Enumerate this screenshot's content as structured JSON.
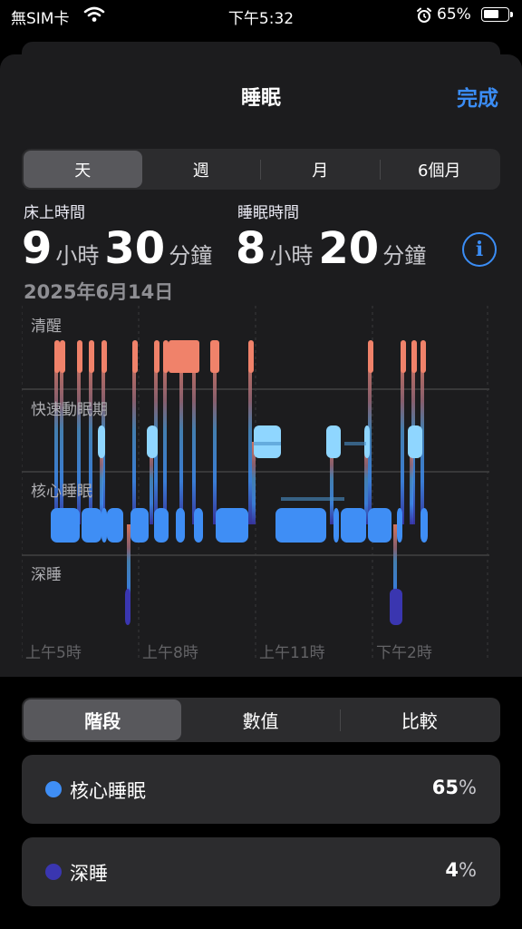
{
  "status_bar": {
    "carrier": "無SIM卡",
    "time": "下午5:32",
    "battery_percent": "65%",
    "battery_level": 0.65
  },
  "nav": {
    "title": "睡眠",
    "done_label": "完成"
  },
  "range_tabs": [
    {
      "label": "天",
      "selected": true
    },
    {
      "label": "週",
      "selected": false
    },
    {
      "label": "月",
      "selected": false
    },
    {
      "label": "6個月",
      "selected": false
    }
  ],
  "summary": {
    "in_bed": {
      "label": "床上時間",
      "hours": "9",
      "hours_unit": "小時",
      "minutes": "30",
      "minutes_unit": "分鐘"
    },
    "asleep": {
      "label": "睡眠時間",
      "hours": "8",
      "hours_unit": "小時",
      "minutes": "20",
      "minutes_unit": "分鐘"
    },
    "date": "2025年6月14日",
    "info_glyph": "i"
  },
  "chart_data": {
    "type": "hypnogram",
    "stages": [
      "清醒",
      "快速動眠期",
      "核心睡眠",
      "深睡"
    ],
    "x_ticks": [
      "上午5時",
      "上午8時",
      "上午11時",
      "下午2時"
    ],
    "colors": {
      "awake": "#f0826a",
      "rem": "#8fd6ff",
      "core": "#3f8ef5",
      "deep": "#3a36b0"
    }
  },
  "bottom_tabs": [
    {
      "label": "階段",
      "selected": true
    },
    {
      "label": "數值",
      "selected": false
    },
    {
      "label": "比較",
      "selected": false
    }
  ],
  "legend_rows": [
    {
      "name": "核心睡眠",
      "value": "65",
      "unit": "%",
      "color": "#3f8ef5"
    },
    {
      "name": "深睡",
      "value": "4",
      "unit": "%",
      "color": "#3a36b0"
    }
  ]
}
